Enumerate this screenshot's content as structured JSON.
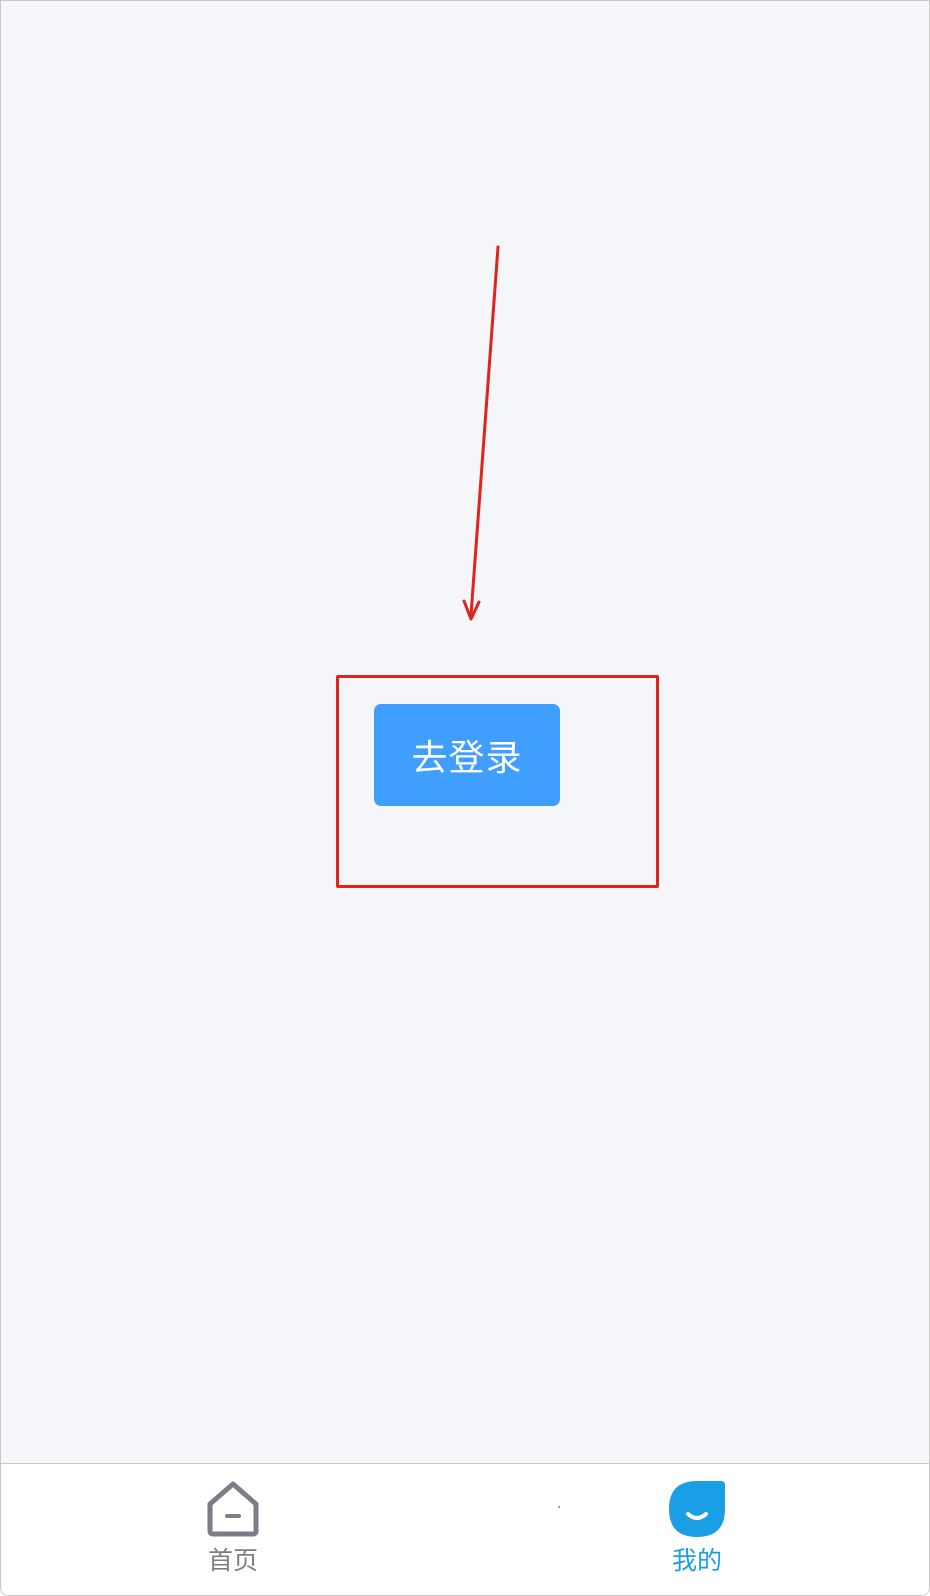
{
  "main": {
    "login_button_label": "去登录"
  },
  "tabbar": {
    "items": [
      {
        "label": "首页",
        "icon": "home-icon",
        "active": false
      },
      {
        "label": "我的",
        "icon": "user-icon",
        "active": true
      }
    ]
  },
  "colors": {
    "page_background": "#f4f6f9",
    "button_primary": "#409eff",
    "annotation_red": "#e0231c",
    "tab_active": "#1a9fe6",
    "tab_inactive": "#7d7d85"
  }
}
